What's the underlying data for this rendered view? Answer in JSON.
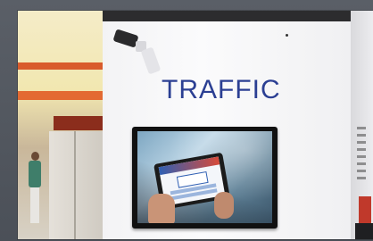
{
  "scene": {
    "wall_sign": "TRAFFIC",
    "sign_color": "#2b3f93"
  },
  "elements": {
    "camera": "security-camera-icon",
    "display": "tv-screen",
    "tablet": "tablet-device"
  }
}
